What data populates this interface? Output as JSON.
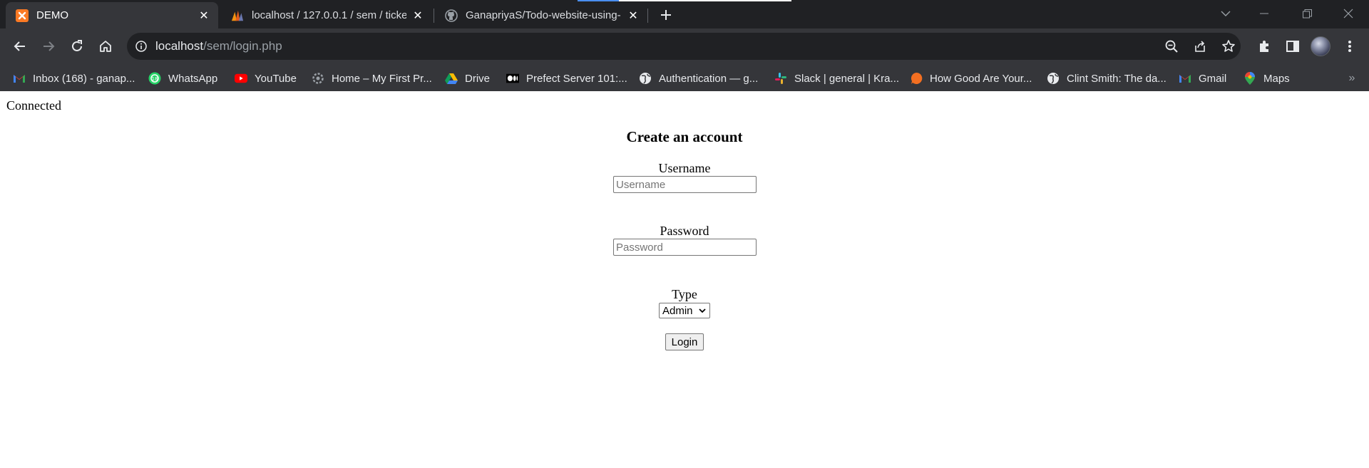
{
  "browser": {
    "tabs": [
      {
        "title": "DEMO",
        "icon": "xampp-icon",
        "active": true
      },
      {
        "title": "localhost / 127.0.0.1 / sem / ticke",
        "icon": "phpmyadmin-icon",
        "active": false
      },
      {
        "title": "GanapriyaS/Todo-website-using-",
        "icon": "github-icon",
        "active": false
      }
    ],
    "address": {
      "host": "localhost",
      "path": "/sem/login.php"
    },
    "bookmarks": [
      {
        "label": "Inbox (168) - ganap...",
        "icon": "gmail-icon"
      },
      {
        "label": "WhatsApp",
        "icon": "whatsapp-icon"
      },
      {
        "label": "YouTube",
        "icon": "youtube-icon"
      },
      {
        "label": "Home – My First Pr...",
        "icon": "gear-icon"
      },
      {
        "label": "Drive",
        "icon": "drive-icon"
      },
      {
        "label": "Prefect Server 101:...",
        "icon": "medium-icon"
      },
      {
        "label": "Authentication — g...",
        "icon": "globe-icon"
      },
      {
        "label": "Slack | general | Kra...",
        "icon": "slack-icon"
      },
      {
        "label": "How Good Are Your...",
        "icon": "orange-bubble-icon"
      },
      {
        "label": "Clint Smith: The da...",
        "icon": "globe-icon"
      },
      {
        "label": "Gmail",
        "icon": "gmail-icon"
      },
      {
        "label": "Maps",
        "icon": "maps-icon"
      }
    ],
    "colors": {
      "tab_strip": "#202124",
      "toolbar": "#35363a",
      "omnibox": "#202124"
    }
  },
  "page": {
    "status": "Connected",
    "heading": "Create an account",
    "username": {
      "label": "Username",
      "placeholder": "Username",
      "value": ""
    },
    "password": {
      "label": "Password",
      "placeholder": "Password",
      "value": ""
    },
    "type": {
      "label": "Type",
      "selected": "Admin"
    },
    "submit_label": "Login"
  }
}
